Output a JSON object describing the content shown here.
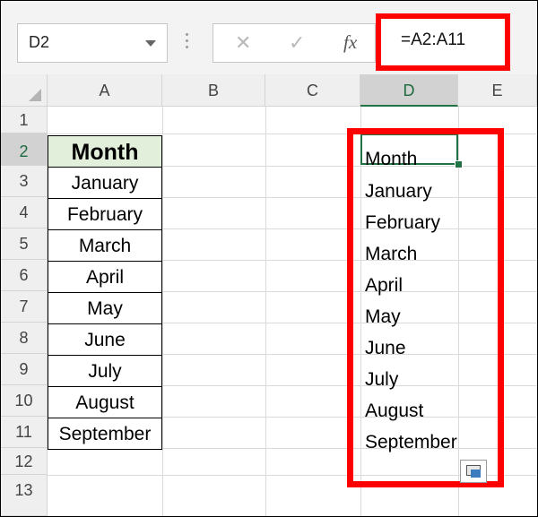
{
  "formula_bar": {
    "name_box": "D2",
    "cancel_icon": "✕",
    "enter_icon": "✓",
    "fx_label": "fx",
    "formula": "=A2:A11"
  },
  "columns": [
    "A",
    "B",
    "C",
    "D",
    "E"
  ],
  "rows": [
    "1",
    "2",
    "3",
    "4",
    "5",
    "6",
    "7",
    "8",
    "9",
    "10",
    "11",
    "12",
    "13"
  ],
  "column_a": {
    "header": "Month",
    "values": [
      "January",
      "February",
      "March",
      "April",
      "May",
      "June",
      "July",
      "August",
      "September"
    ]
  },
  "column_d": [
    "Month",
    "January",
    "February",
    "March",
    "April",
    "May",
    "June",
    "July",
    "August",
    "September"
  ],
  "selection": {
    "active_cell": "D2",
    "highlight_color": "#ff0000",
    "header_fill": "#e2efda",
    "excel_green": "#217346"
  }
}
